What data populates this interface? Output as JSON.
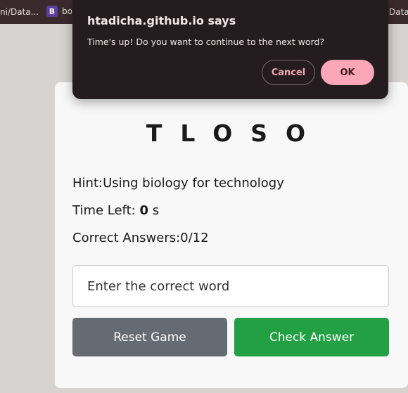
{
  "bookmarks": [
    {
      "label": "ni/Data...",
      "icon": ""
    },
    {
      "label": "bo",
      "icon": "bootstrap-icon",
      "icon_glyph": "B"
    },
    {
      "label": "DataL",
      "icon": ""
    }
  ],
  "game": {
    "scrambled_word": "TLOSO",
    "hint": "Hint:Using biology for technology",
    "time_label": "Time Left: ",
    "time_value": "0",
    "time_unit": " s",
    "correct_answers": "Correct Answers:0/12",
    "input_placeholder": "Enter the correct word",
    "input_value": "",
    "reset_label": "Reset Game",
    "check_label": "Check Answer"
  },
  "dialog": {
    "title": "htadicha.github.io says",
    "message": "Time's up! Do you want to continue to the next word?",
    "cancel_label": "Cancel",
    "ok_label": "OK"
  },
  "colors": {
    "page_bg": "#d6d3d2",
    "bookmarks_bg": "#3a2a2d",
    "card_bg": "#f8f8f8",
    "reset_button": "#646b73",
    "check_button": "#22a043",
    "dialog_bg": "#241c1e",
    "ok_button": "#fba7b8",
    "cancel_text": "#f3a9b8"
  }
}
